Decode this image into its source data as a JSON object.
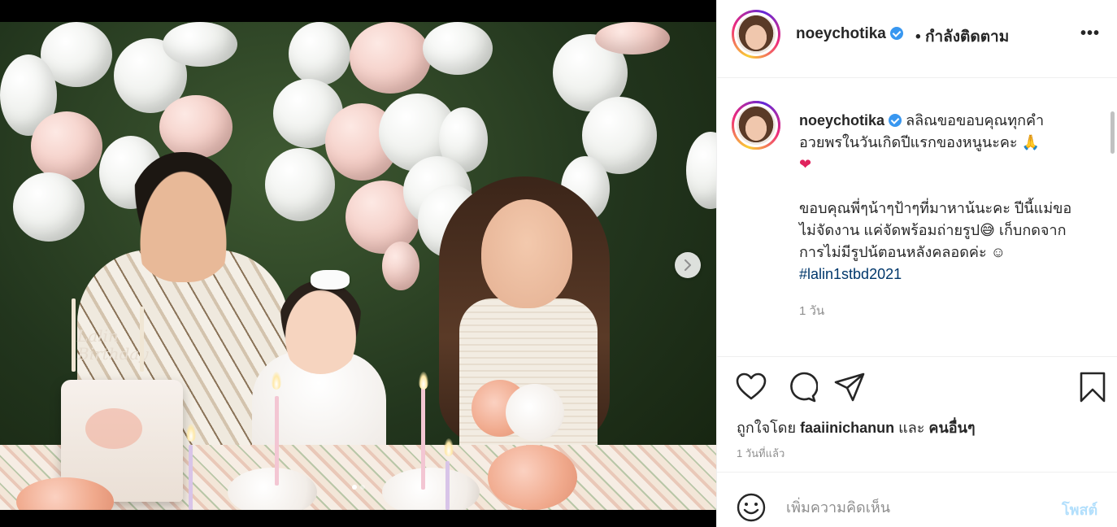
{
  "post": {
    "username": "noeychotika",
    "separator": "•",
    "follow_status": "กำลังติดตาม",
    "more_label": "•••",
    "photo_topper": "Lalin Birthday"
  },
  "caption": {
    "username": "noeychotika",
    "text1": "ลลิณขอขอบคุณทุกคำอวยพรในวันเกิดปีแรกของหนูนะคะ 🙏",
    "heart": "❤",
    "text2": "ขอบคุณพี่ๆน้าๆป้าๆที่มาหาน้นะคะ ปีนี้แม่ขอไม่จัดงาน แค่จัดพร้อมถ่ายรูป😅 เก็บกดจากการไม่มีรูปน้ตอนหลังคลอดค่ะ ☺",
    "hashtag": "#lalin1stbd2021",
    "ago": "1 วัน"
  },
  "actions": {
    "liked_by_prefix": "ถูกใจโดย",
    "liked_by_user": "faaiinichanun",
    "liked_by_and": "และ",
    "liked_by_others": "คนอื่นๆ",
    "timestamp": "1 วันที่แล้ว"
  },
  "composer": {
    "placeholder": "เพิ่มความคิดเห็น",
    "post_label": "โพสต์"
  },
  "carousel": {
    "dot_count": 2,
    "active_index": 0
  },
  "icons": {
    "like": "heart-outline-icon",
    "comment": "comment-bubble-icon",
    "share": "paper-plane-icon",
    "save": "bookmark-icon",
    "emoji": "smiley-icon",
    "next": "chevron-right-icon"
  },
  "colors": {
    "verified": "#3897f0",
    "hashtag": "#00376b",
    "post_button": "#b2dffc",
    "secondary_text": "#8e8e8e"
  }
}
